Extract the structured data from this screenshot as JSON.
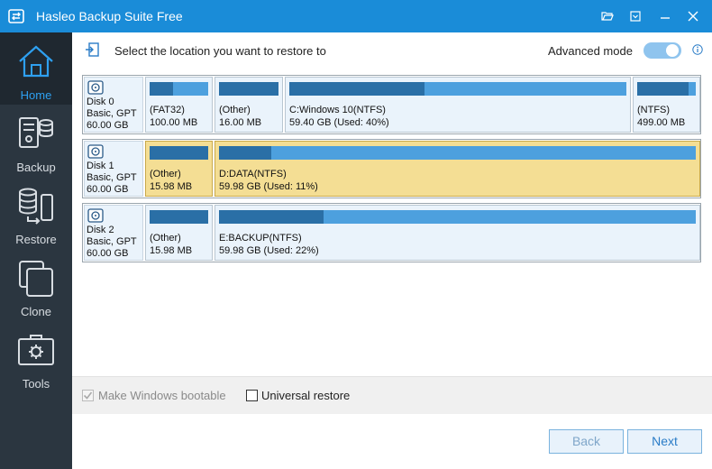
{
  "window": {
    "title": "Hasleo Backup Suite Free",
    "icons": [
      "app-logo-icon",
      "folder-open-icon",
      "menu-dropdown-icon",
      "minimize-icon",
      "close-icon"
    ]
  },
  "sidebar": {
    "items": [
      {
        "label": "Home",
        "icon": "home-icon",
        "active": true
      },
      {
        "label": "Backup",
        "icon": "backup-icon"
      },
      {
        "label": "Restore",
        "icon": "restore-icon"
      },
      {
        "label": "Clone",
        "icon": "clone-icon"
      },
      {
        "label": "Tools",
        "icon": "tools-icon"
      }
    ],
    "collapse_icon": "double-chevron-left-icon"
  },
  "header": {
    "instruction": "Select the location you want to restore to",
    "advanced_mode_label": "Advanced mode",
    "advanced_mode_on": true
  },
  "disks": [
    {
      "name": "Disk 0",
      "type": "Basic, GPT",
      "size": "60.00 GB",
      "partitions": [
        {
          "label": "(FAT32)",
          "size": "100.00 MB",
          "used_fraction": 0.4
        },
        {
          "label": "(Other)",
          "size": "16.00 MB",
          "used_fraction": 1.0
        },
        {
          "label": "C:Windows 10(NTFS)",
          "size": "59.40 GB (Used: 40%)",
          "used_fraction": 0.4
        },
        {
          "label": "(NTFS)",
          "size": "499.00 MB",
          "used_fraction": 0.88
        }
      ]
    },
    {
      "name": "Disk 1",
      "type": "Basic, GPT",
      "size": "60.00 GB",
      "selected": true,
      "partitions": [
        {
          "label": "(Other)",
          "size": "15.98 MB",
          "used_fraction": 1.0
        },
        {
          "label": "D:DATA(NTFS)",
          "size": "59.98 GB (Used: 11%)",
          "used_fraction": 0.11
        }
      ]
    },
    {
      "name": "Disk 2",
      "type": "Basic, GPT",
      "size": "60.00 GB",
      "partitions": [
        {
          "label": "(Other)",
          "size": "15.98 MB",
          "used_fraction": 1.0
        },
        {
          "label": "E:BACKUP(NTFS)",
          "size": "59.98 GB (Used: 22%)",
          "used_fraction": 0.22
        }
      ]
    }
  ],
  "options": {
    "make_bootable": {
      "label": "Make Windows bootable",
      "checked": true,
      "disabled": true
    },
    "universal_restore": {
      "label": "Universal restore",
      "checked": false
    }
  },
  "footer": {
    "back_label": "Back",
    "next_label": "Next"
  },
  "colors": {
    "titlebar": "#1a8cd8",
    "sidebar": "#2b3640",
    "accent": "#2ea0f0",
    "selected_partition": "#f4de94",
    "bar_free": "#4da0de",
    "bar_used": "#2a6fa6"
  }
}
